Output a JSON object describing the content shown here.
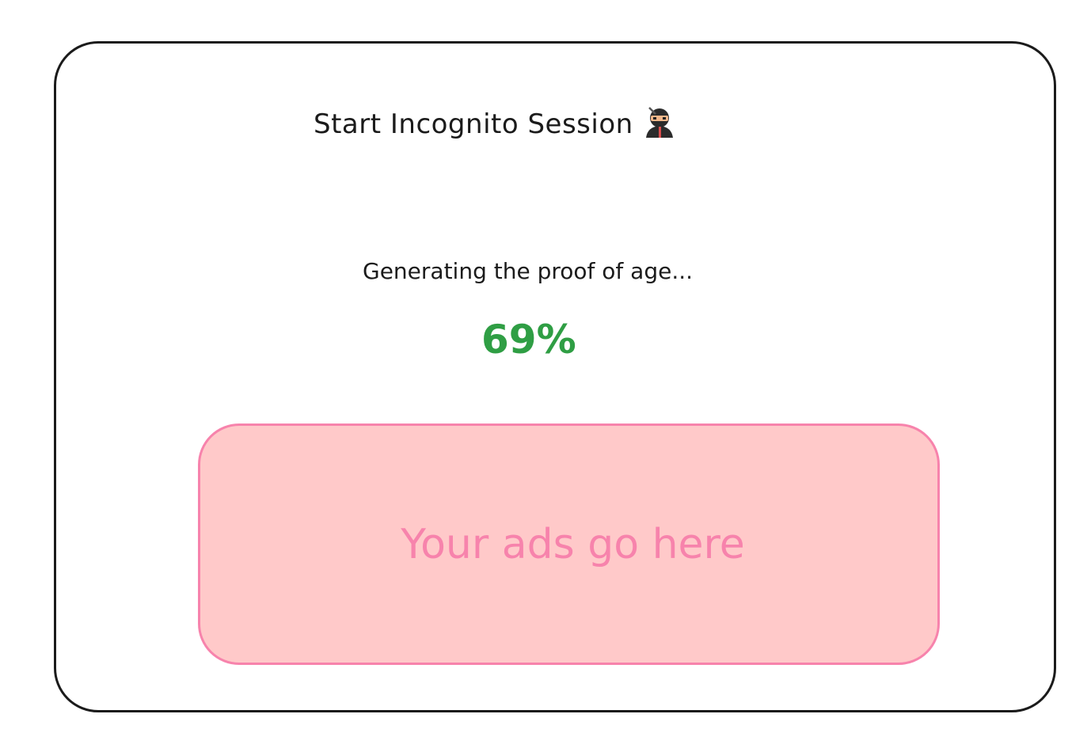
{
  "card": {
    "title": "Start Incognito Session",
    "title_icon": "ninja-icon"
  },
  "progress": {
    "status_text": "Generating the proof of age...",
    "percent_label": "69%",
    "percent_value": 69
  },
  "ad": {
    "text": "Your ads go here"
  },
  "colors": {
    "card_border": "#1b1b1b",
    "progress_text": "#2f9e44",
    "ad_background": "#ffc9c9",
    "ad_accent": "#f783ac"
  }
}
